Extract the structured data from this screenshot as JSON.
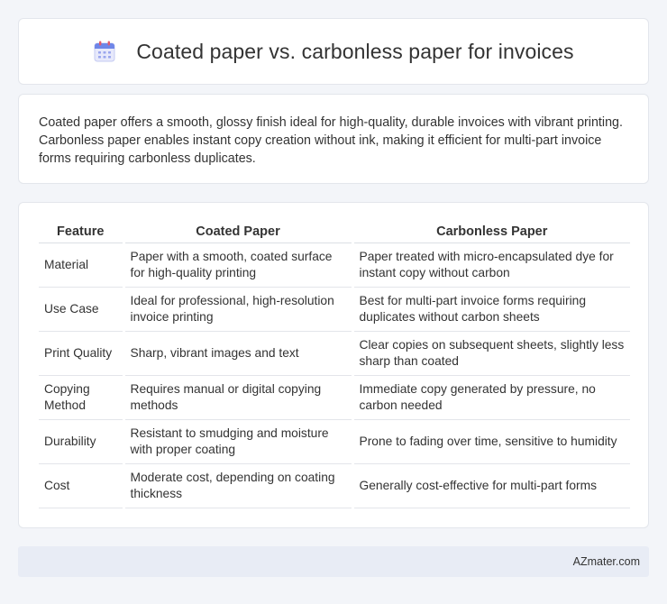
{
  "header": {
    "title": "Coated paper vs. carbonless paper for invoices",
    "icon": "calendar-icon"
  },
  "intro": {
    "text": "Coated paper offers a smooth, glossy finish ideal for high-quality, durable invoices with vibrant printing. Carbonless paper enables instant copy creation without ink, making it efficient for multi-part invoice forms requiring carbonless duplicates."
  },
  "table": {
    "headers": [
      "Feature",
      "Coated Paper",
      "Carbonless Paper"
    ],
    "rows": [
      [
        "Material",
        "Paper with a smooth, coated surface for high-quality printing",
        "Paper treated with micro-encapsulated dye for instant copy without carbon"
      ],
      [
        "Use Case",
        "Ideal for professional, high-resolution invoice printing",
        "Best for multi-part invoice forms requiring duplicates without carbon sheets"
      ],
      [
        "Print Quality",
        "Sharp, vibrant images and text",
        "Clear copies on subsequent sheets, slightly less sharp than coated"
      ],
      [
        "Copying Method",
        "Requires manual or digital copying methods",
        "Immediate copy generated by pressure, no carbon needed"
      ],
      [
        "Durability",
        "Resistant to smudging and moisture with proper coating",
        "Prone to fading over time, sensitive to humidity"
      ],
      [
        "Cost",
        "Moderate cost, depending on coating thickness",
        "Generally cost-effective for multi-part forms"
      ]
    ]
  },
  "footer": {
    "brand": "AZmater.com"
  }
}
